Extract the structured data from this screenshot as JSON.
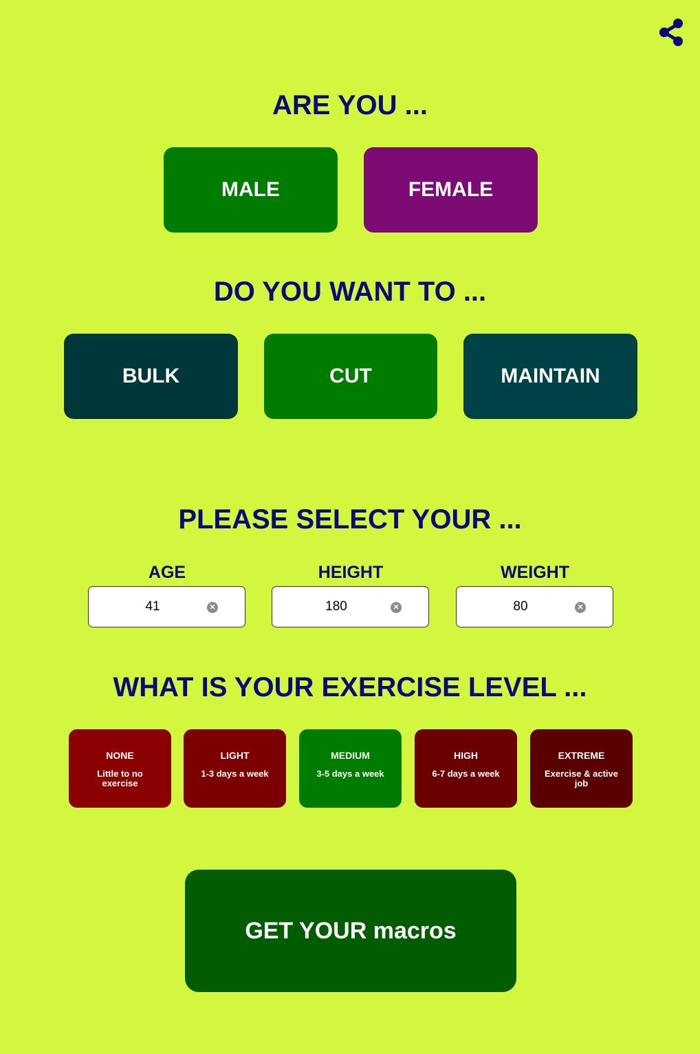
{
  "share": {
    "icon": "share-icon",
    "color": "#0a0a7a"
  },
  "gender": {
    "heading": "ARE YOU ...",
    "options": [
      {
        "label": "MALE",
        "color": "#007c00"
      },
      {
        "label": "FEMALE",
        "color": "#7c0c74"
      }
    ]
  },
  "goal": {
    "heading": "DO YOU WANT TO ...",
    "options": [
      {
        "label": "BULK",
        "color": "#00373a"
      },
      {
        "label": "CUT",
        "color": "#007c00"
      },
      {
        "label": "MAINTAIN",
        "color": "#004246"
      }
    ]
  },
  "stats": {
    "heading": "PLEASE SELECT YOUR ...",
    "fields": [
      {
        "label": "AGE",
        "value": "41"
      },
      {
        "label": "HEIGHT",
        "value": "180"
      },
      {
        "label": "WEIGHT",
        "value": "80"
      }
    ]
  },
  "exercise": {
    "heading": "WHAT IS YOUR EXERCISE LEVEL ...",
    "options": [
      {
        "title": "NONE",
        "subtitle": "Little to no exercise",
        "color": "#8b0000"
      },
      {
        "title": "LIGHT",
        "subtitle": "1-3 days a week",
        "color": "#7c0000"
      },
      {
        "title": "MEDIUM",
        "subtitle": "3-5 days a week",
        "color": "#007c00"
      },
      {
        "title": "HIGH",
        "subtitle": "6-7 days a week",
        "color": "#6a0000"
      },
      {
        "title": "EXTREME",
        "subtitle": "Exercise & active job",
        "color": "#5a0000"
      }
    ]
  },
  "cta": {
    "label": "GET YOUR macros",
    "color": "#025c02"
  },
  "theme": {
    "background": "#d3f73e",
    "heading_color": "#0a0a7a"
  }
}
